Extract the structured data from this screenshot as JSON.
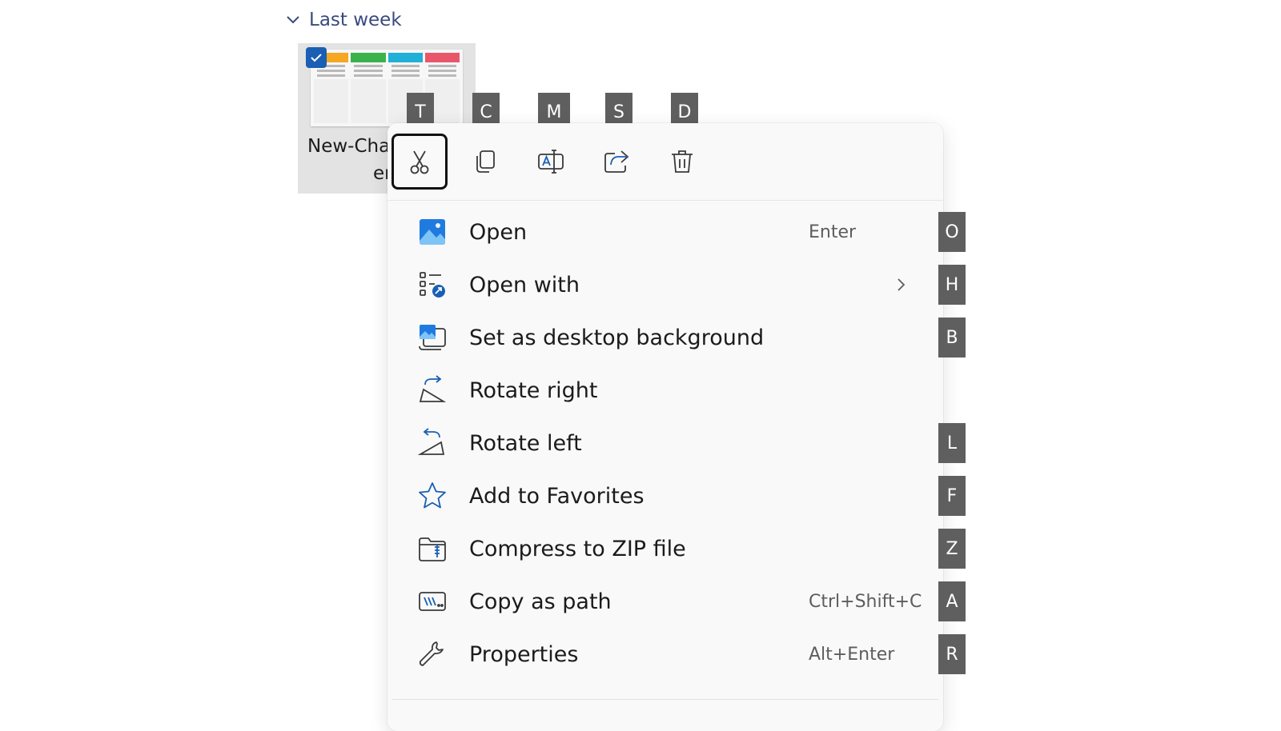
{
  "group": {
    "label": "Last week"
  },
  "file": {
    "name_line1": "New-Cha",
    "name_line2": "er",
    "selected": true
  },
  "toolbar": {
    "items": [
      {
        "name": "cut",
        "key": "T",
        "icon": "scissors-icon",
        "focused": true
      },
      {
        "name": "copy",
        "key": "C",
        "icon": "copy-icon"
      },
      {
        "name": "rename",
        "key": "M",
        "icon": "rename-icon"
      },
      {
        "name": "share",
        "key": "S",
        "icon": "share-icon"
      },
      {
        "name": "delete",
        "key": "D",
        "icon": "trash-icon"
      }
    ]
  },
  "menu": {
    "items": [
      {
        "label": "Open",
        "shortcut": "Enter",
        "key": "O",
        "icon": "photo-icon"
      },
      {
        "label": "Open with",
        "shortcut": "",
        "key": "H",
        "icon": "open-with-icon",
        "submenu": true
      },
      {
        "label": "Set as desktop background",
        "shortcut": "",
        "key": "B",
        "icon": "desktop-background-icon"
      },
      {
        "label": "Rotate right",
        "shortcut": "",
        "key": "",
        "icon": "rotate-right-icon"
      },
      {
        "label": "Rotate left",
        "shortcut": "",
        "key": "L",
        "icon": "rotate-left-icon"
      },
      {
        "label": "Add to Favorites",
        "shortcut": "",
        "key": "F",
        "icon": "star-icon"
      },
      {
        "label": "Compress to ZIP file",
        "shortcut": "",
        "key": "Z",
        "icon": "zip-folder-icon"
      },
      {
        "label": "Copy as path",
        "shortcut": "Ctrl+Shift+C",
        "key": "A",
        "icon": "copy-path-icon"
      },
      {
        "label": "Properties",
        "shortcut": "Alt+Enter",
        "key": "R",
        "icon": "wrench-icon"
      }
    ]
  },
  "colors": {
    "accent": "#1a5fb4",
    "badge": "#5f5f5f",
    "menu_bg": "#f9f9f9"
  }
}
